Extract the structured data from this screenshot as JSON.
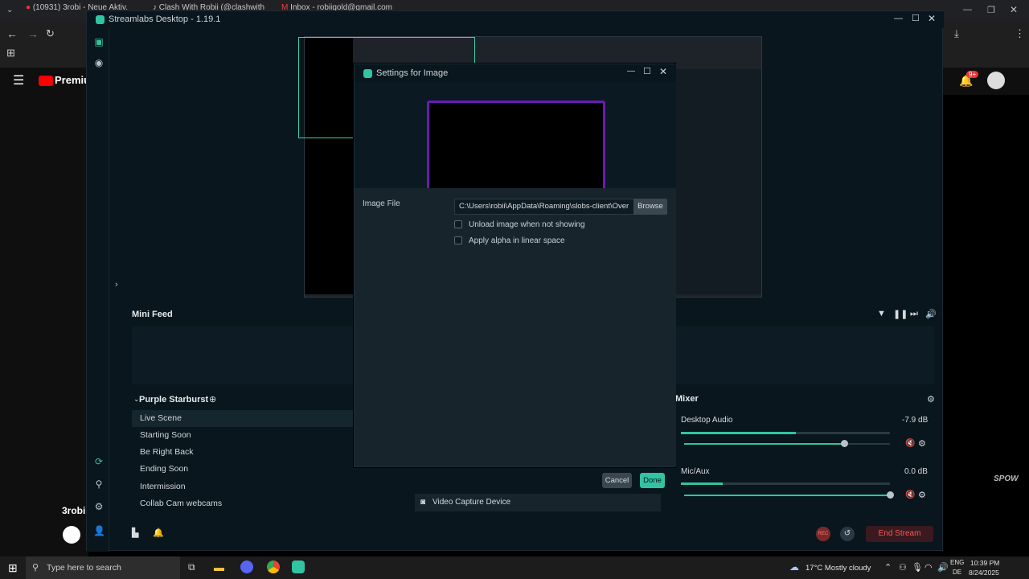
{
  "browser": {
    "tabs": [
      "(10931) 3robi - Neue Aktiv...",
      "Clash With Robii (@clashwith...",
      "Inbox - robiigold@gmail.com"
    ],
    "brand": "Premium"
  },
  "youtube": {
    "channel_name": "3robi",
    "notifications": "9+",
    "watermark": "SPOW"
  },
  "slobs": {
    "title": "Streamlabs Desktop - 1.19.1",
    "mini_feed": "Mini Feed",
    "scene_collection": "Purple Starburst",
    "scenes": [
      "Live Scene",
      "Starting Soon",
      "Be Right Back",
      "Ending Soon",
      "Intermission",
      "Collab Cam webcams"
    ],
    "active_scene": "Live Scene",
    "source_item": "Video Capture Device",
    "mixer": {
      "title": "Mixer",
      "channels": [
        {
          "name": "Desktop Audio",
          "db": "-7.9 dB",
          "level": 0.55,
          "volume": 0.78
        },
        {
          "name": "Mic/Aux",
          "db": "0.0 dB",
          "level": 0.2,
          "volume": 1.0
        }
      ]
    },
    "end_stream": "End Stream",
    "rec": "REC"
  },
  "dialog": {
    "title": "Settings for Image",
    "image_file_label": "Image File",
    "image_path": "C:\\Users\\robii\\AppData\\Roaming\\slobs-client\\Over",
    "browse": "Browse",
    "unload_label": "Unload image when not showing",
    "alpha_label": "Apply alpha in linear space",
    "cancel": "Cancel",
    "done": "Done",
    "frame_color": "#6a1bb1"
  },
  "taskbar": {
    "search_placeholder": "Type here to search",
    "weather": "17°C Mostly cloudy",
    "lang": "ENG",
    "region": "DE",
    "time": "10:39 PM",
    "date": "8/24/2025"
  },
  "colors": {
    "accent": "#31c3a2",
    "bg": "#09161d",
    "danger": "#e23c3c"
  }
}
